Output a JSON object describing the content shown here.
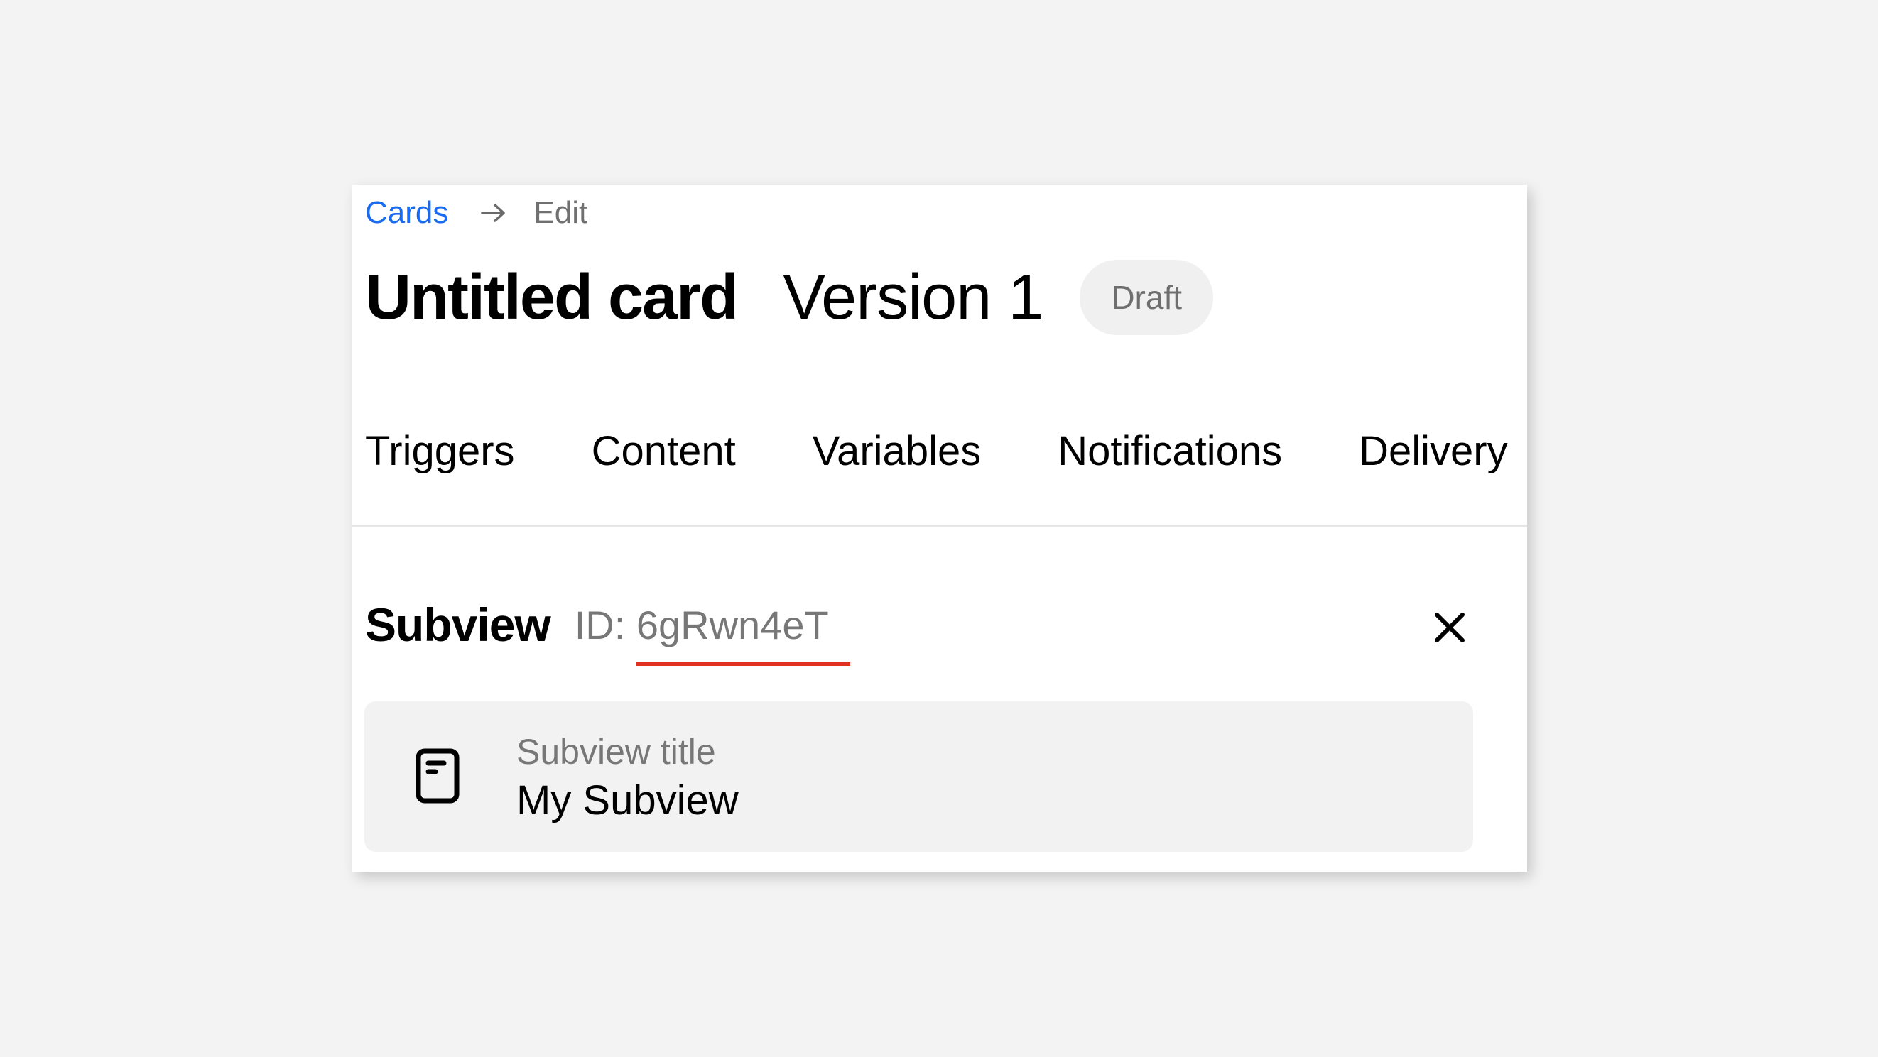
{
  "breadcrumb": {
    "parent": "Cards",
    "separator_icon": "arrow-right-icon",
    "current": "Edit"
  },
  "header": {
    "title": "Untitled card",
    "version": "Version 1",
    "status_badge": "Draft"
  },
  "tabs": [
    {
      "label": "Triggers"
    },
    {
      "label": "Content"
    },
    {
      "label": "Variables"
    },
    {
      "label": "Notifications"
    },
    {
      "label": "Delivery"
    }
  ],
  "subview": {
    "heading": "Subview",
    "id_prefix": "ID: ",
    "id_value": "6gRwn4eT",
    "close_icon": "close-icon",
    "field": {
      "icon": "document-icon",
      "label": "Subview title",
      "value": "My Subview"
    }
  },
  "colors": {
    "link": "#1a6bf0",
    "underline_accent": "#e0301e",
    "background": "#f3f3f3",
    "badge_bg": "#f0f0f0"
  }
}
